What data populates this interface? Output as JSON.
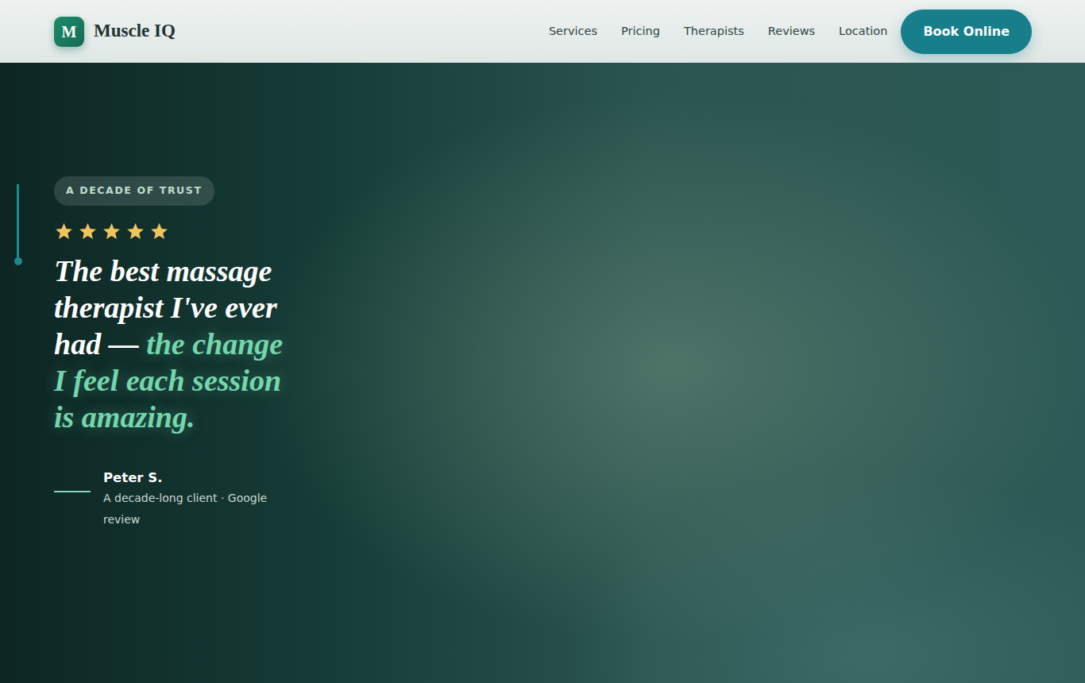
{
  "brand": {
    "logo_letter": "M",
    "name": "Muscle IQ"
  },
  "nav": {
    "links": [
      "Services",
      "Pricing",
      "Therapists",
      "Reviews",
      "Location"
    ],
    "cta": "Book Online"
  },
  "hero": {
    "badge": "A DECADE OF TRUST",
    "rating": {
      "stars": 5
    },
    "quote": {
      "main": "The best massage therapist I've ever had — ",
      "highlight": "the change I feel each session is amazing."
    },
    "author": {
      "name": "Peter S.",
      "detail": "A decade-long client · Google review"
    }
  }
}
